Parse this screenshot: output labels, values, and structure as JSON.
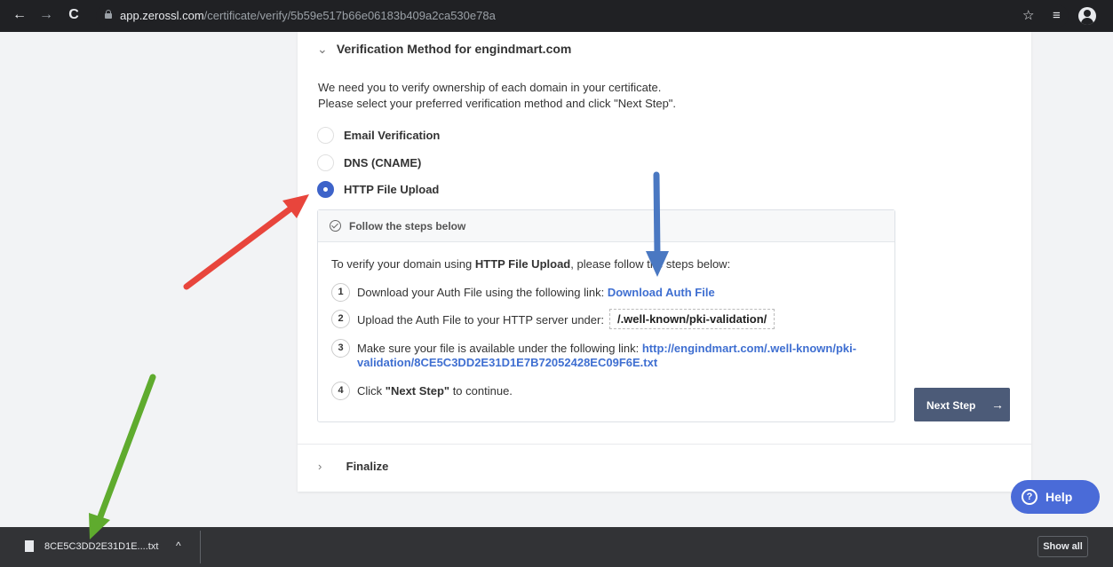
{
  "browser": {
    "url_host": "app.zerossl.com",
    "url_path": "/certificate/verify/5b59e517b66e06183b409a2ca530e78a"
  },
  "verification": {
    "heading": "Verification Method for engindmart.com",
    "intro_line1": "We need you to verify ownership of each domain in your certificate.",
    "intro_line2": "Please select your preferred verification method and click \"Next Step\".",
    "options": [
      {
        "label": "Email Verification",
        "selected": false
      },
      {
        "label": "DNS (CNAME)",
        "selected": false
      },
      {
        "label": "HTTP File Upload",
        "selected": true
      }
    ]
  },
  "steps": {
    "title": "Follow the steps below",
    "intro_pre": "To verify your domain using ",
    "intro_bold": "HTTP File Upload",
    "intro_post": ", please follow the steps below:",
    "items": [
      {
        "num": "1",
        "text": "Download your Auth File using the following link: ",
        "link": "Download Auth File"
      },
      {
        "num": "2",
        "text": "Upload the Auth File to your HTTP server under:",
        "path": "/.well-known/pki-validation/"
      },
      {
        "num": "3",
        "text": "Make sure your file is available under the following link: ",
        "link_line1": "http://engindmart.com/.well-known/pki-",
        "link_line2": "validation/8CE5C3DD2E31D1E7B72052428EC09F6E.txt"
      },
      {
        "num": "4",
        "text_pre": "Click ",
        "text_bold": "\"Next Step\"",
        "text_post": " to continue."
      }
    ]
  },
  "next_button": {
    "label": "Next Step",
    "arrow": "→"
  },
  "finalize": {
    "label": "Finalize"
  },
  "help": {
    "label": "Help",
    "icon": "?"
  },
  "downloads": {
    "file_name": "8CE5C3DD2E31D1E....txt",
    "show_all": "Show all"
  },
  "annotation_colors": {
    "red": "#e8453c",
    "blue": "#4a78c2",
    "green": "#5fab2e"
  }
}
